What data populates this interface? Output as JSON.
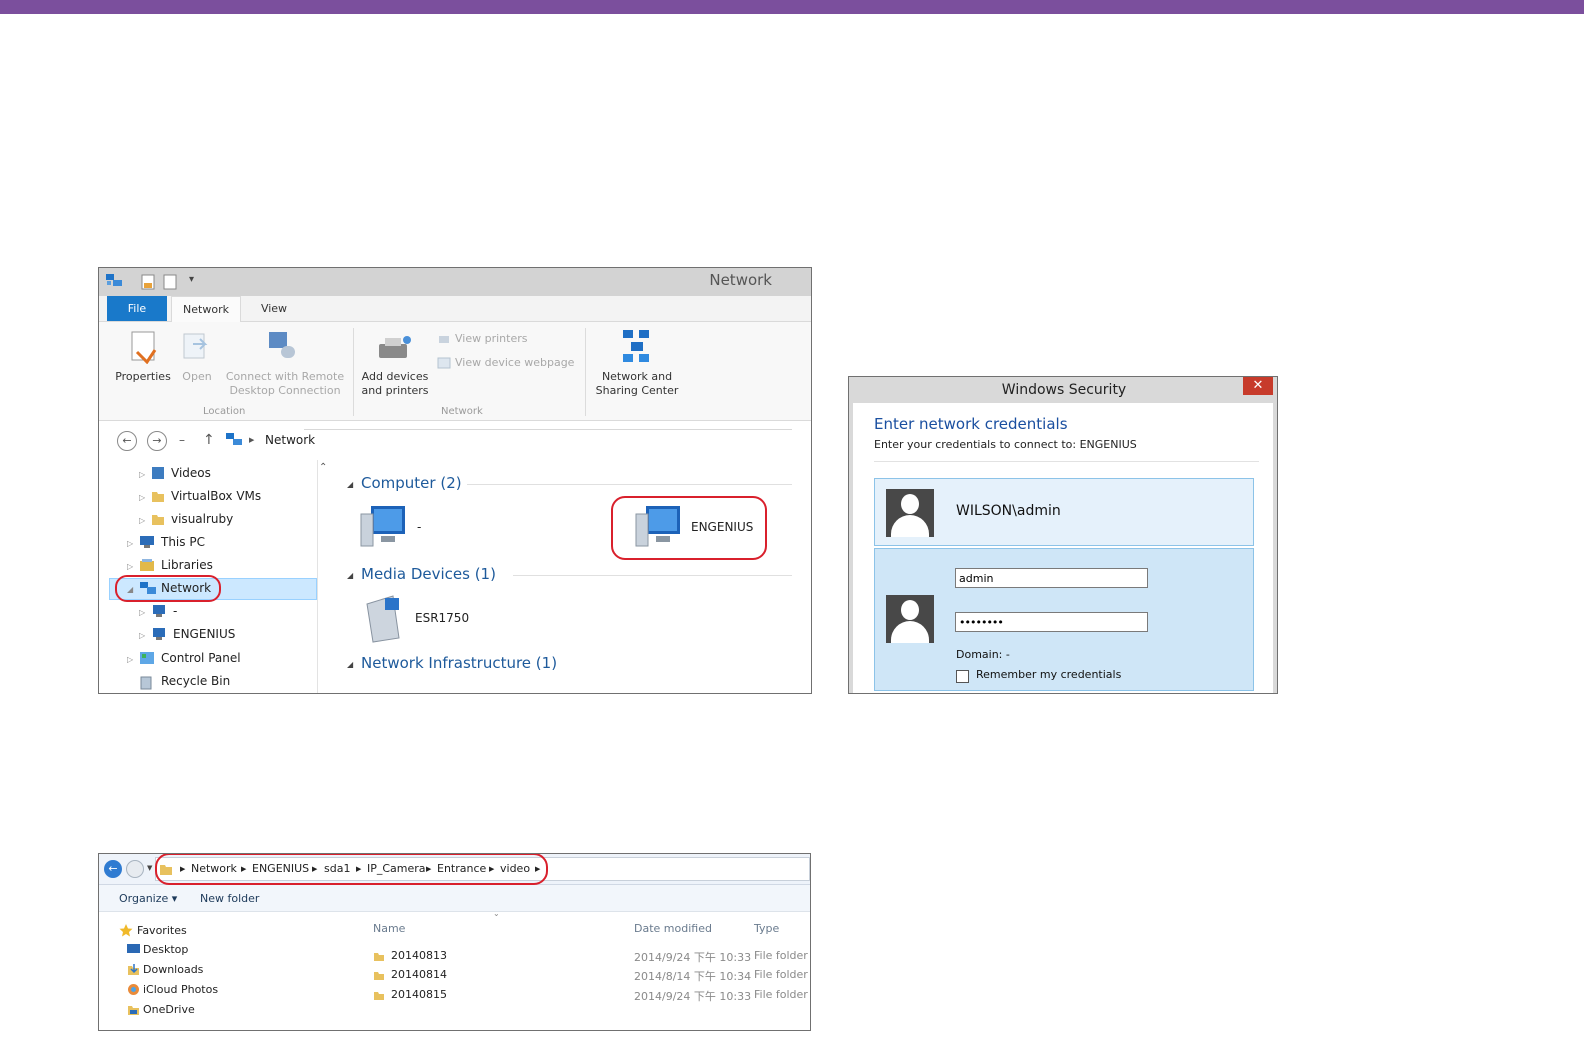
{
  "explorer": {
    "window_title": "Network",
    "tabs": [
      "File",
      "Network",
      "View"
    ],
    "ribbon": {
      "properties": "Properties",
      "open": "Open",
      "connect_remote_1": "Connect with Remote",
      "connect_remote_2": "Desktop Connection",
      "add_devices_1": "Add devices",
      "add_devices_2": "and printers",
      "view_printers": "View printers",
      "view_device_webpage": "View device webpage",
      "network_sharing_1": "Network and",
      "network_sharing_2": "Sharing Center",
      "group_location": "Location",
      "group_network": "Network"
    },
    "address": {
      "dash": "–",
      "location": "Network"
    },
    "tree": [
      {
        "label": "Videos"
      },
      {
        "label": "VirtualBox VMs"
      },
      {
        "label": "visualruby"
      },
      {
        "label": "This PC"
      },
      {
        "label": "Libraries"
      },
      {
        "label": "Network"
      },
      {
        "label": "-"
      },
      {
        "label": "ENGENIUS"
      },
      {
        "label": "Control Panel"
      },
      {
        "label": "Recycle Bin"
      }
    ],
    "groups": {
      "computer": "Computer (2)",
      "media": "Media Devices (1)",
      "infra": "Network Infrastructure (1)"
    },
    "items": {
      "computer_dash": "-",
      "engenius": "ENGENIUS",
      "esr": "ESR1750"
    },
    "colors": {
      "file_tab": "#1979ca",
      "ring": "#d9202c"
    }
  },
  "security": {
    "title": "Windows Security",
    "close": "✕",
    "heading": "Enter network credentials",
    "subtitle": "Enter your credentials to connect to: ENGENIUS",
    "saved_user": "WILSON\\admin",
    "username": "admin",
    "password": "••••••••",
    "domain": "Domain: -",
    "remember": "Remember my credentials"
  },
  "explorer2": {
    "breadcrumb": [
      "Network",
      "ENGENIUS",
      "sda1",
      "IP_Camera",
      "Entrance",
      "video"
    ],
    "toolbar": {
      "organize": "Organize ▾",
      "new_folder": "New folder"
    },
    "nav": [
      "Favorites",
      "Desktop",
      "Downloads",
      "iCloud Photos",
      "OneDrive"
    ],
    "columns": [
      "Name",
      "Date modified",
      "Type"
    ],
    "rows": [
      {
        "name": "20140813",
        "date": "2014/9/24 下午 10:33",
        "type": "File folder"
      },
      {
        "name": "20140814",
        "date": "2014/8/14 下午 10:34",
        "type": "File folder"
      },
      {
        "name": "20140815",
        "date": "2014/9/24 下午 10:33",
        "type": "File folder"
      }
    ]
  }
}
